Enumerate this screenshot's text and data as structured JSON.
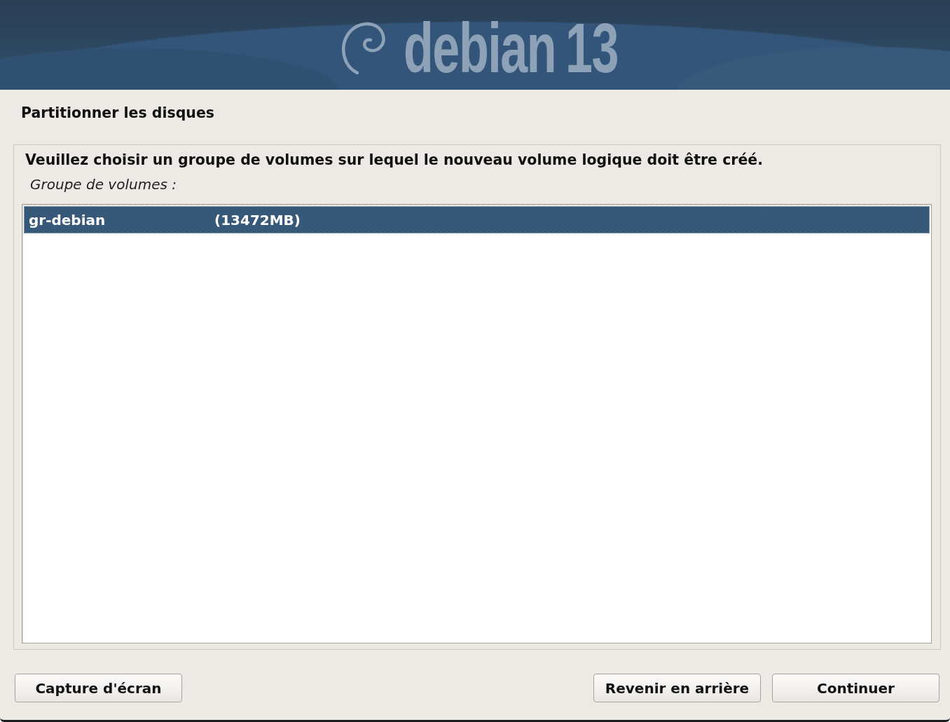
{
  "banner": {
    "wordmark": "debian",
    "version": "13"
  },
  "page_title": "Partitionner les disques",
  "question": "Veuillez choisir un groupe de volumes sur lequel le nouveau volume logique doit être créé.",
  "list_label": "Groupe de volumes :",
  "volume_groups": [
    {
      "name": "gr-debian",
      "size": "(13472MB)",
      "selected": true
    }
  ],
  "screenshot_button": "Capture d'écran",
  "nav_buttons": [
    "Revenir en arrière",
    "Continuer"
  ]
}
